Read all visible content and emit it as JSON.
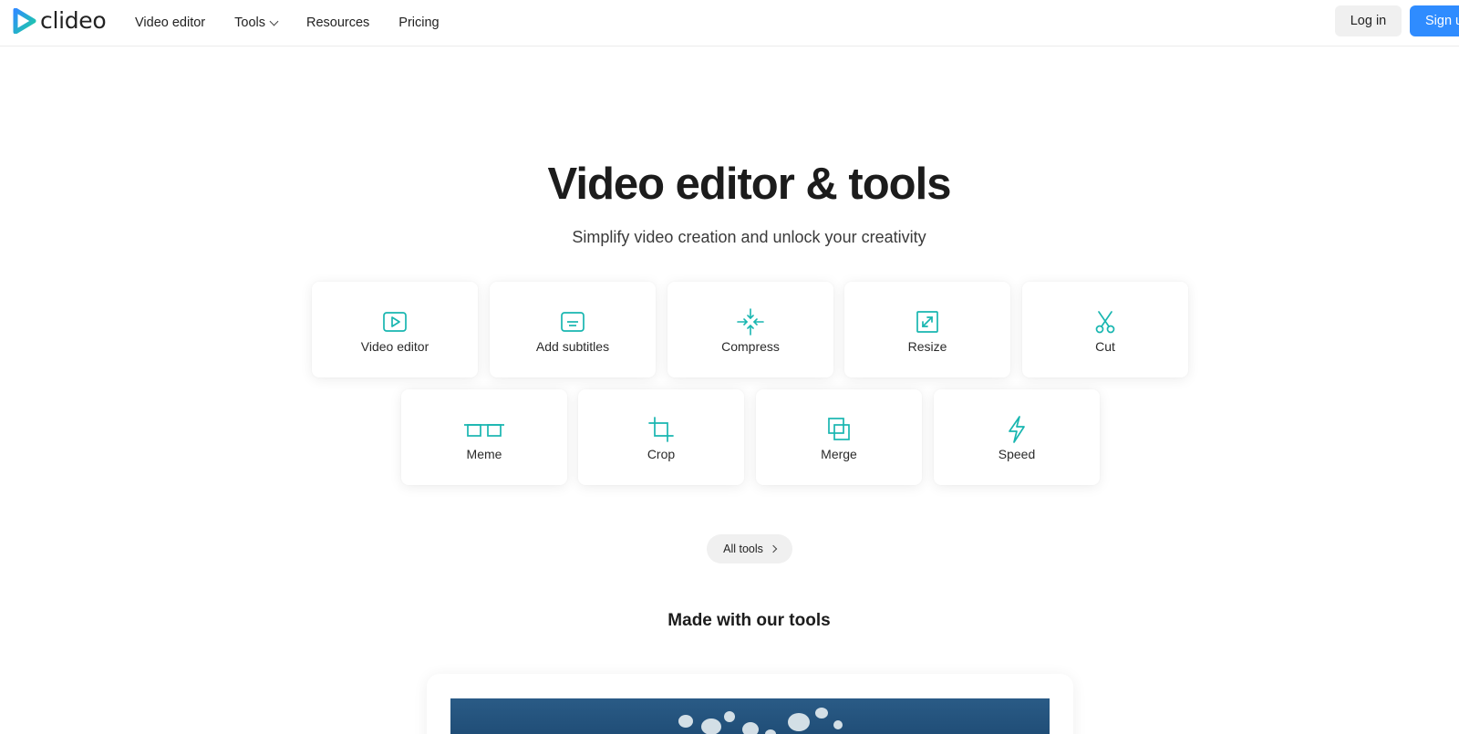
{
  "header": {
    "logo_text": "clideo",
    "nav": [
      {
        "label": "Video editor"
      },
      {
        "label": "Tools",
        "has_dropdown": true
      },
      {
        "label": "Resources"
      },
      {
        "label": "Pricing"
      }
    ],
    "login_label": "Log in",
    "signup_label": "Sign up"
  },
  "hero": {
    "title": "Video editor & tools",
    "subtitle": "Simplify video creation and unlock your creativity"
  },
  "tools": [
    {
      "label": "Video editor",
      "icon": "video-editor-icon"
    },
    {
      "label": "Add subtitles",
      "icon": "subtitles-icon"
    },
    {
      "label": "Compress",
      "icon": "compress-icon"
    },
    {
      "label": "Resize",
      "icon": "resize-icon"
    },
    {
      "label": "Cut",
      "icon": "scissors-icon"
    },
    {
      "label": "Meme",
      "icon": "meme-icon"
    },
    {
      "label": "Crop",
      "icon": "crop-icon"
    },
    {
      "label": "Merge",
      "icon": "merge-icon"
    },
    {
      "label": "Speed",
      "icon": "lightning-icon"
    }
  ],
  "all_tools_label": "All tools",
  "made_with": {
    "title": "Made with our tools"
  },
  "colors": {
    "accent": "#18b6b0",
    "primary_button": "#2f8cff",
    "text": "#1f1f1f"
  }
}
